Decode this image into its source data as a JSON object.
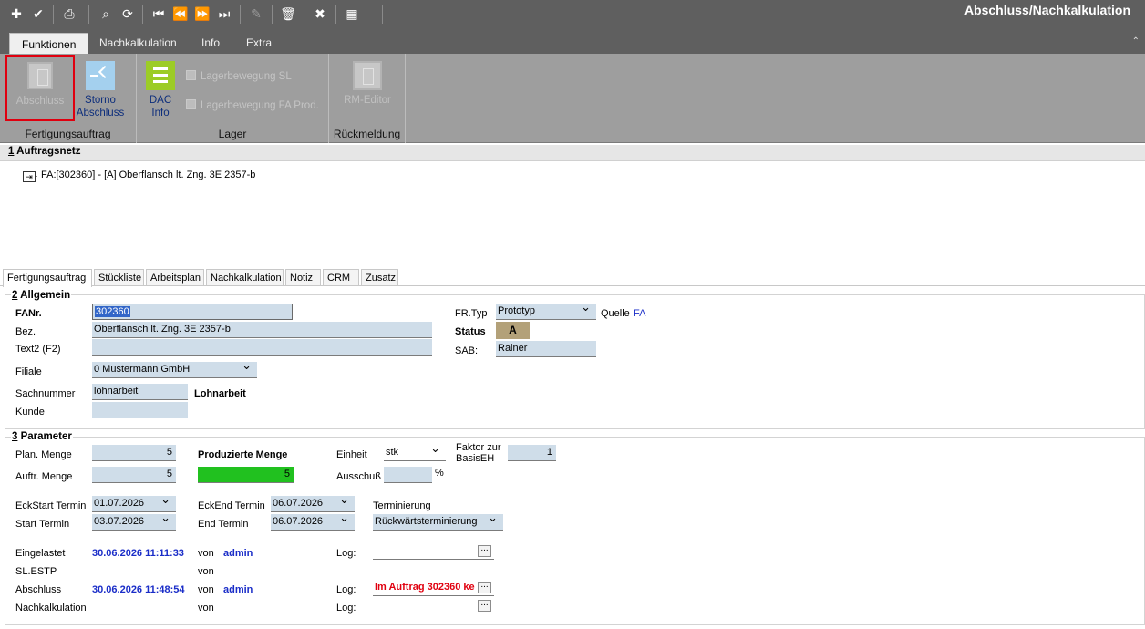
{
  "window": {
    "title": "Abschluss/Nachkalkulation"
  },
  "ribbon_tabs": [
    "Funktionen",
    "Nachkalkulation",
    "Info",
    "Extra"
  ],
  "ribbon": {
    "groups": [
      "Fertigungsauftrag",
      "Lager",
      "Rückmeldung"
    ],
    "abschluss": "Abschluss",
    "storno_1": "Storno",
    "storno_2": "Abschluss",
    "dac_1": "DAC",
    "dac_2": "Info",
    "lager1": "Lagerbewegung SL",
    "lager2": "Lagerbewegung FA Prod.",
    "rm": "RM-Editor"
  },
  "net": {
    "header_num": "1",
    "header_text": " Auftragsnetz",
    "node": "FA:[302360] - [A] Oberflansch lt. Zng. 3E 2357-b"
  },
  "tabs": [
    "Fertigungsauftrag",
    "Stückliste",
    "Arbeitsplan",
    "Nachkalkulation",
    "Notiz",
    "CRM",
    "Zusatz"
  ],
  "allgemein": {
    "header_num": "2",
    "header_text": " Allgemein",
    "fanr_label": "FANr.",
    "fanr": "302360",
    "bez_label": "Bez.",
    "bez": "Oberflansch lt. Zng. 3E 2357-b",
    "text2_label": "Text2 (F2)",
    "text2": "",
    "filiale_label": "Filiale",
    "filiale": "0  Mustermann GmbH",
    "sachnummer_label": "Sachnummer",
    "sachnummer": "lohnarbeit",
    "sachnummer_desc": "Lohnarbeit",
    "kunde_label": "Kunde",
    "kunde": "",
    "frtyp_label": "FR.Typ",
    "frtyp": "Prototyp",
    "quelle_label": "Quelle",
    "quelle": "FA",
    "status_label": "Status",
    "status": "A",
    "sab_label": "SAB:",
    "sab": "Rainer"
  },
  "parameter": {
    "header_num": "3",
    "header_text": " Parameter",
    "plan_label": "Plan. Menge",
    "plan": "5",
    "auftr_label": "Auftr. Menge",
    "auftr": "5",
    "prod_label": "Produzierte Menge",
    "prod": "5",
    "einheit_label": "Einheit",
    "einheit": "stk",
    "ausschuss_label": "Ausschuß",
    "ausschuss": "",
    "pct": "%",
    "faktor_label_1": "Faktor zur",
    "faktor_label_2": "BasisEH",
    "faktor": "1",
    "eckstart_label": "EckStart Termin",
    "eckstart": "01.07.2026",
    "start_label": "Start Termin",
    "start": "03.07.2026",
    "eckend_label": "EckEnd Termin",
    "eckend": "06.07.2026",
    "end_label": "End Termin",
    "end": "06.07.2026",
    "term_label": "Terminierung",
    "term": "Rückwärtsterminierung",
    "eing_label": "Eingelastet",
    "eing_date": "30.06.2026 11:11:33",
    "eing_von": "von",
    "eing_user": "admin",
    "slestp_label": "SL.ESTP",
    "slestp_von": "von",
    "abschl_label": "Abschluss",
    "abschl_date": "30.06.2026 11:48:54",
    "abschl_von": "von",
    "abschl_user": "admin",
    "nachk_label": "Nachkalkulation",
    "nachk_von": "von",
    "log_label": "Log:",
    "log_abschl": "Im Auftrag 302360 ke"
  },
  "colors": {
    "toolbar": "#5f5f5f",
    "ribbon": "#9e9e9e",
    "accent_green": "#21c11f",
    "status_bg": "#b3a179",
    "highlight_red": "#e0000f"
  }
}
